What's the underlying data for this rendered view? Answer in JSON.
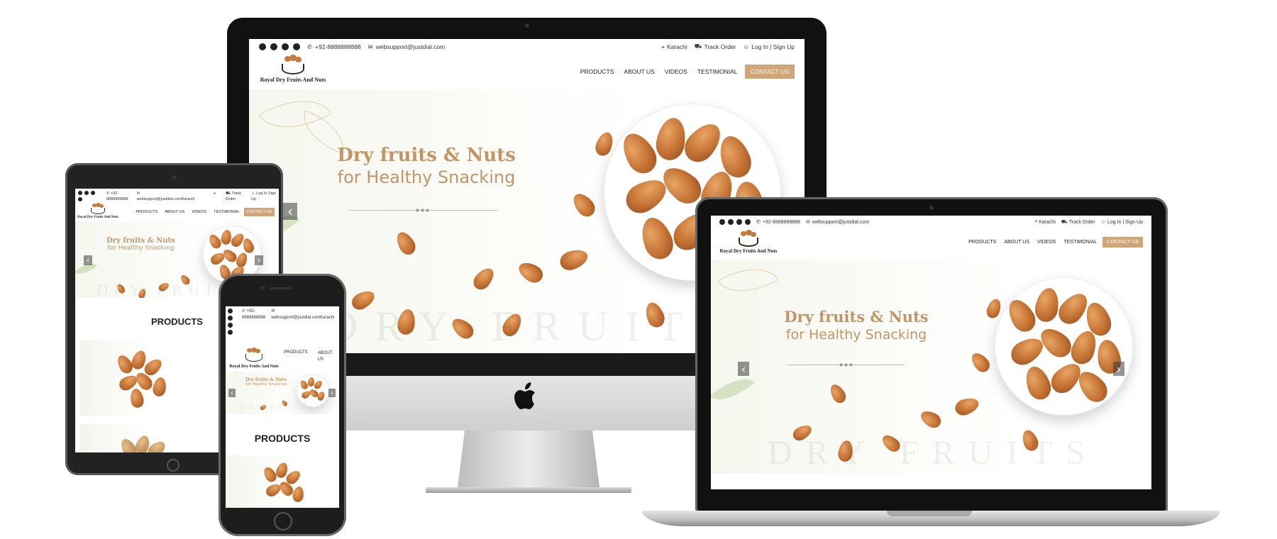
{
  "site": {
    "phone": "+92-8888888888",
    "phone_short": "+92-",
    "phone_rest": "8888888888",
    "email": "websupport@justdial.com",
    "email_tablet": "websupport@justdial.comKarachi",
    "location": "Karachi",
    "track_order": "Track Order",
    "track_short": "Track",
    "track_rest": "Order",
    "login": "Log In | Sign Up",
    "login_short": "Log In  Sign",
    "login_rest": "Up",
    "brand_name": "Royal Dry Fruits And Nuts",
    "nav": {
      "products": "PRODUCTS",
      "about": "ABOUT US",
      "about_top": "ABOUT",
      "about_bottom": "US",
      "videos": "VIDEOS",
      "testimonial": "TESTIMONIAL",
      "contact": "CONTACT US"
    },
    "hero": {
      "title": "Dry fruits & Nuts",
      "subtitle": "for Healthy Snacking",
      "watermark": "DRY FRUITS"
    },
    "products_heading": "PRODUCTS"
  },
  "icons": {
    "prev": "‹",
    "next": "›",
    "apple": ""
  }
}
